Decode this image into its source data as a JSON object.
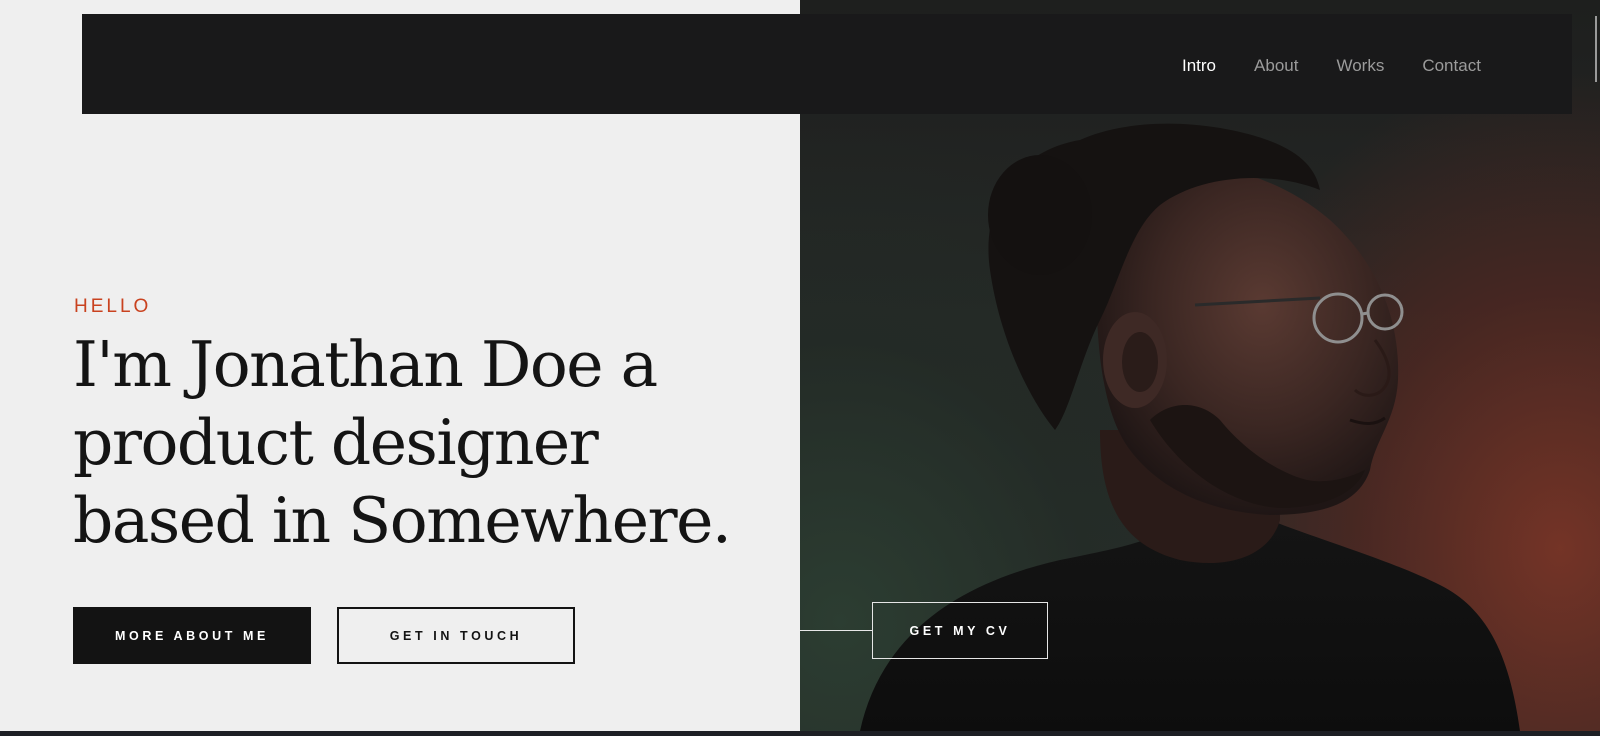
{
  "nav": {
    "items": [
      {
        "label": "Intro",
        "active": true
      },
      {
        "label": "About",
        "active": false
      },
      {
        "label": "Works",
        "active": false
      },
      {
        "label": "Contact",
        "active": false
      }
    ]
  },
  "hero": {
    "eyebrow": "HELLO",
    "headline": "I'm Jonathan Doe a product designer based in Somewhere.",
    "primary_button": "MORE ABOUT ME",
    "secondary_button": "GET IN TOUCH",
    "cv_button": "GET MY CV"
  },
  "colors": {
    "accent": "#c9421f",
    "dark": "#131313",
    "light_bg": "#efefef",
    "header_bg": "#19191a"
  }
}
